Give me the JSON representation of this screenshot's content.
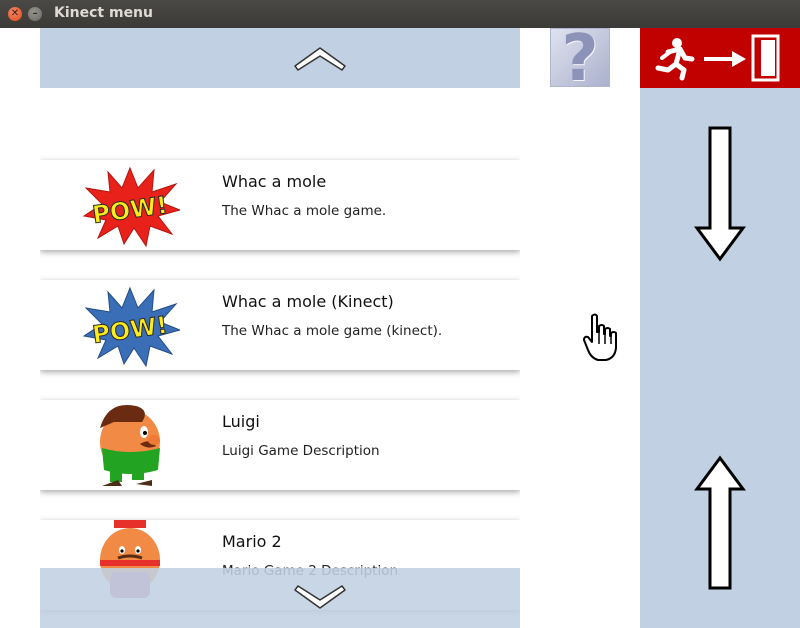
{
  "window": {
    "title": "Kinect menu"
  },
  "colors": {
    "scroll_bar_bg": "#c1d0e2",
    "exit_bg": "#c10000",
    "card_bg": "#ffffff"
  },
  "header": {
    "help_symbol": "?"
  },
  "games": [
    {
      "title": "Whac a mole",
      "description": "The Whac a mole game.",
      "thumb_text": "POW!",
      "thumb_icon": "pow-red-icon"
    },
    {
      "title": "Whac a mole (Kinect)",
      "description": "The Whac a mole game (kinect).",
      "thumb_text": "POW!",
      "thumb_icon": "pow-blue-icon"
    },
    {
      "title": "Luigi",
      "description": "Luigi Game Description",
      "thumb_icon": "luigi-character-icon"
    },
    {
      "title": "Mario 2",
      "description": "Mario Game 2 Description",
      "thumb_icon": "mario-character-icon"
    }
  ]
}
